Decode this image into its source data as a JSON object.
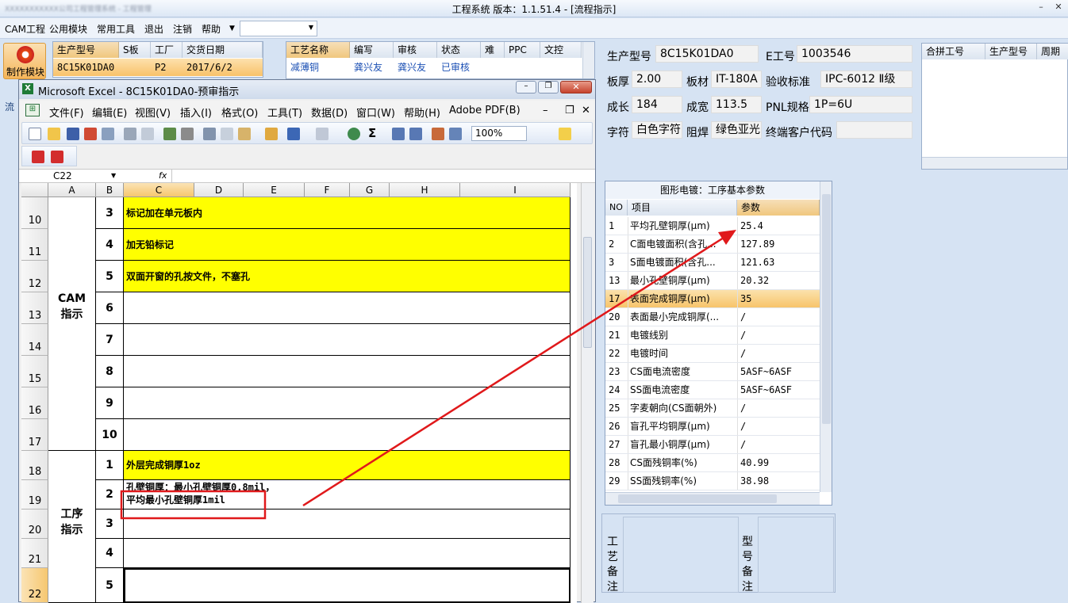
{
  "app": {
    "title": "工程系统    版本：1.1.51.4 - [流程指示]",
    "blurred_title": "XXXXXXXXXXX公司工程管理系统 - 工程管理"
  },
  "menu": {
    "items": [
      "CAM工程",
      "公用模块",
      "常用工具",
      "退出",
      "注销",
      "帮助"
    ],
    "combo_value": ""
  },
  "left": {
    "module_button": "制作模块",
    "tab_label": "流"
  },
  "orders_grid": {
    "headers": [
      "生产型号",
      "S板",
      "工厂",
      "交货日期"
    ],
    "row": [
      "8C15K01DA0",
      "",
      "P2",
      "2017/6/2"
    ]
  },
  "process_grid": {
    "headers": [
      "工艺名称",
      "编写",
      "审核",
      "状态",
      "难",
      "PPC",
      "文控"
    ],
    "row": [
      "减薄铜",
      "龚兴友",
      "龚兴友",
      "已审核",
      "",
      "",
      ""
    ]
  },
  "info": {
    "model_label": "生产型号",
    "model_value": "8C15K01DA0",
    "e_label": "E工号",
    "e_value": "1003546",
    "thick_label": "板厚",
    "thick_value": "2.00",
    "material_label": "板材",
    "material_value": "IT-180A",
    "std_label": "验收标准",
    "std_value": "IPC-6012 Ⅱ级",
    "len_label": "成长",
    "len_value": "184",
    "width_label": "成宽",
    "width_value": "113.5",
    "pnl_label": "PNL规格",
    "pnl_value": "1P=6U",
    "char_label": "字符",
    "char_value": "白色字符",
    "mask_label": "阻焊",
    "mask_value": "绿色亚光",
    "cust_label": "终端客户代码",
    "cust_value": ""
  },
  "merge_grid": {
    "headers": [
      "合拼工号",
      "生产型号",
      "周期"
    ]
  },
  "params": {
    "title": "图形电镀：工序基本参数",
    "headers": [
      "NO",
      "项目",
      "参数"
    ],
    "rows": [
      {
        "no": "1",
        "item": "平均孔壁铜厚(μm)",
        "value": "25.4"
      },
      {
        "no": "2",
        "item": "C面电镀面积(含孔...",
        "value": "127.89"
      },
      {
        "no": "3",
        "item": "S面电镀面积(含孔...",
        "value": "121.63"
      },
      {
        "no": "13",
        "item": "最小孔壁铜厚(μm)",
        "value": "20.32"
      },
      {
        "no": "17",
        "item": "表面完成铜厚(μm)",
        "value": "35"
      },
      {
        "no": "20",
        "item": "表面最小完成铜厚(...",
        "value": "/"
      },
      {
        "no": "21",
        "item": "电镀线别",
        "value": "/"
      },
      {
        "no": "22",
        "item": "电镀时间",
        "value": "/"
      },
      {
        "no": "23",
        "item": "CS面电流密度",
        "value": "5ASF~6ASF"
      },
      {
        "no": "24",
        "item": "SS面电流密度",
        "value": "5ASF~6ASF"
      },
      {
        "no": "25",
        "item": "字麦朝向(CS面朝外)",
        "value": "/"
      },
      {
        "no": "26",
        "item": "盲孔平均铜厚(μm)",
        "value": "/"
      },
      {
        "no": "27",
        "item": "盲孔最小铜厚(μm)",
        "value": "/"
      },
      {
        "no": "28",
        "item": "CS面残铜率(%)",
        "value": "40.99"
      },
      {
        "no": "29",
        "item": "SS面残铜率(%)",
        "value": "38.98"
      }
    ]
  },
  "notes": {
    "process_note": "工艺备注",
    "model_note": "型号备注"
  },
  "excel": {
    "title": "Microsoft Excel - 8C15K01DA0-预审指示",
    "menu": [
      "文件(F)",
      "编辑(E)",
      "视图(V)",
      "插入(I)",
      "格式(O)",
      "工具(T)",
      "数据(D)",
      "窗口(W)",
      "帮助(H)",
      "Adobe PDF(B)"
    ],
    "zoom": "100%",
    "name_box": "C22",
    "fx": "fx",
    "columns": [
      "A",
      "B",
      "C",
      "D",
      "E",
      "F",
      "G",
      "H",
      "I"
    ],
    "rows": [
      "10",
      "11",
      "12",
      "13",
      "14",
      "15",
      "16",
      "17",
      "18",
      "19",
      "20",
      "21",
      "22"
    ],
    "group1": "CAM指示",
    "group2": "工序指示",
    "cam_items": [
      {
        "n": "3",
        "text": "标记加在单元板内"
      },
      {
        "n": "4",
        "text": "加无铅标记"
      },
      {
        "n": "5",
        "text": "双面开窗的孔按文件，不塞孔"
      },
      {
        "n": "6",
        "text": ""
      },
      {
        "n": "7",
        "text": ""
      },
      {
        "n": "8",
        "text": ""
      },
      {
        "n": "9",
        "text": ""
      },
      {
        "n": "10",
        "text": ""
      }
    ],
    "proc_items": [
      {
        "n": "1",
        "text": "外层完成铜厚1oz"
      },
      {
        "n": "2",
        "line1": "孔壁铜厚：最小孔壁铜厚0.8mil，",
        "line2": "平均最小孔壁铜厚1mil"
      },
      {
        "n": "3",
        "text": ""
      },
      {
        "n": "4",
        "text": ""
      },
      {
        "n": "5",
        "text": ""
      }
    ]
  },
  "colors": {
    "highlight_yellow": "#ffff00",
    "annotation_red": "#e0191b",
    "orange_header": "#f7c46a"
  }
}
